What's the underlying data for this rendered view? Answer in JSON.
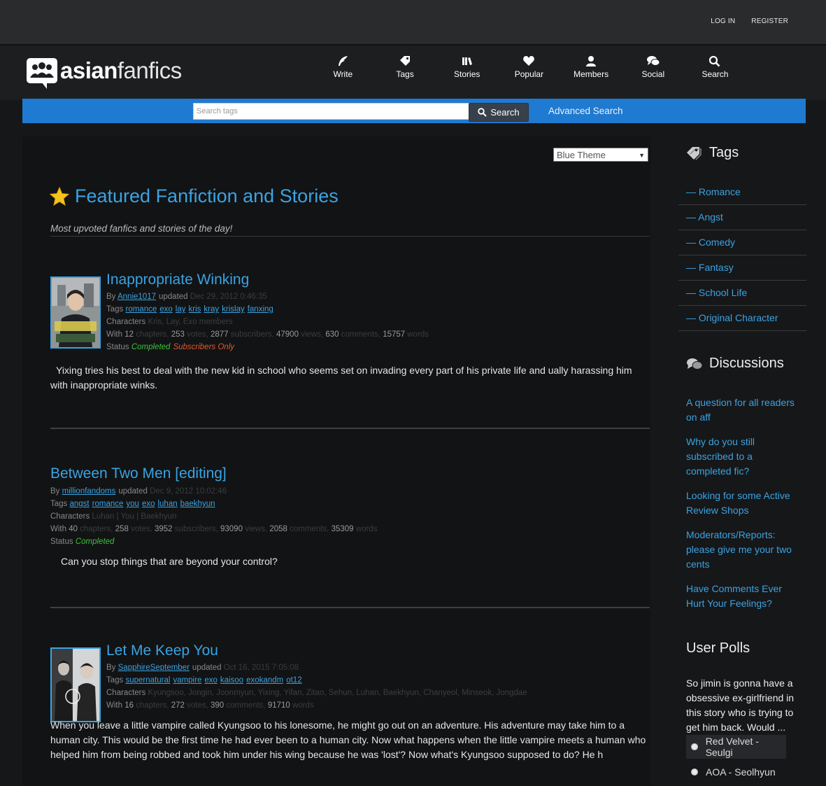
{
  "top": {
    "login": "LOG IN",
    "register": "REGISTER"
  },
  "logo": {
    "bold": "asian",
    "thin": "fanfics"
  },
  "nav": [
    {
      "label": "Write",
      "icon": "quill-icon"
    },
    {
      "label": "Tags",
      "icon": "tag-icon"
    },
    {
      "label": "Stories",
      "icon": "books-icon"
    },
    {
      "label": "Popular",
      "icon": "heart-icon"
    },
    {
      "label": "Members",
      "icon": "user-icon"
    },
    {
      "label": "Social",
      "icon": "chat-icon"
    },
    {
      "label": "Search",
      "icon": "search-icon"
    }
  ],
  "search": {
    "placeholder": "Search tags",
    "button": "Search",
    "advanced": "Advanced Search"
  },
  "theme": {
    "selected": "Blue Theme"
  },
  "featured": {
    "title": "Featured Fanfiction and Stories",
    "subtitle": "Most upvoted fanfics and stories of the day!"
  },
  "stories": [
    {
      "title": "Inappropriate Winking",
      "by_label": "By",
      "author": "Annie1017",
      "updated_label": "updated",
      "date": "Dec 29, 2012 0:46:35",
      "tags_label": "Tags",
      "tags": [
        "romance",
        "exo",
        "lay",
        "kris",
        "kray",
        "krislay",
        "fanxing"
      ],
      "chars_label": "Characters",
      "characters": "Kris, Lay, Exo members",
      "with_label": "With",
      "chapters": "12",
      "chapters_label": "chapters,",
      "votes": "253",
      "votes_label": "votes,",
      "subscribers": "2877",
      "subscribers_label": "subscribers,",
      "views": "47900",
      "views_label": "views,",
      "comments": "630",
      "comments_label": "comments,",
      "words": "15757",
      "words_label": "words",
      "status_label": "Status",
      "status": "Completed",
      "extra_status": "Subscribers Only",
      "description": "Yixing tries his best to deal with the new kid in school who seems set on invading every part of his private life and ually harassing him with inappropriate winks."
    },
    {
      "title": "Between Two Men [editing]",
      "by_label": "By",
      "author": "millionfandoms",
      "updated_label": "updated",
      "date": "Dec 9, 2012 10:02:46",
      "tags_label": "Tags",
      "tags": [
        "angst",
        "romance",
        "you",
        "exo",
        "luhan",
        "baekhyun"
      ],
      "chars_label": "Characters",
      "characters": "Luhan | You | Baekhyun",
      "with_label": "With",
      "chapters": "40",
      "chapters_label": "chapters,",
      "votes": "258",
      "votes_label": "votes,",
      "subscribers": "3952",
      "subscribers_label": "subscribers,",
      "views": "93090",
      "views_label": "views,",
      "comments": "2058",
      "comments_label": "comments,",
      "words": "35309",
      "words_label": "words",
      "status_label": "Status",
      "status": "Completed",
      "description": "Can you stop things that are beyond your control?"
    },
    {
      "title": "Let Me Keep You",
      "by_label": "By",
      "author": "SapphireSeptember",
      "updated_label": "updated",
      "date": "Oct 16, 2015 7:05:08",
      "tags_label": "Tags",
      "tags": [
        "supernatural",
        "vampire",
        "exo",
        "kaisoo",
        "exokandm",
        "ot12"
      ],
      "chars_label": "Characters",
      "characters": "Kyungsoo, Jongin, Joonmyun, Yixing, Yifan, Zitao, Sehun, Luhan, Baekhyun, Chanyeol, Minseok, Jongdae",
      "with_label": "With",
      "chapters": "16",
      "chapters_label": "chapters,",
      "votes": "272",
      "votes_label": "votes,",
      "comments": "390",
      "comments_label": "comments,",
      "words": "91710",
      "words_label": "words",
      "description": "When you leave a little vampire called Kyungsoo to his lonesome, he might go out on an adventure. His adventure may take him to a human city. This would be the first time he had ever been to a human city. Now what happens when the little vampire meets a human who helped him from being robbed and took him under his wing because he was 'lost'? Now what's Kyungsoo supposed to do? He h"
    }
  ],
  "sidebar": {
    "tags_title": "Tags",
    "tags": [
      "— Romance",
      "— Angst",
      "— Comedy",
      "— Fantasy",
      "— School Life",
      "— Original Character"
    ],
    "discussions_title": "Discussions",
    "discussions": [
      "A question for all readers on aff",
      "Why do you still subscribed to a completed fic?",
      "Looking for some Active Review Shops",
      "Moderators/Reports: please give me your two cents",
      "Have Comments Ever Hurt Your Feelings?"
    ],
    "polls_title": "User Polls",
    "poll_question": "So jimin is gonna have a obsessive ex-girlfriend in this story who is trying to get him back. Would ...",
    "poll_options": [
      "Red Velvet - Seulgi",
      "AOA - Seolhyun"
    ]
  },
  "colors": {
    "accent": "#3aa3e3",
    "searchbar": "#1f7ad1",
    "completed": "#39c339",
    "subscribers_only": "#e2582b"
  }
}
